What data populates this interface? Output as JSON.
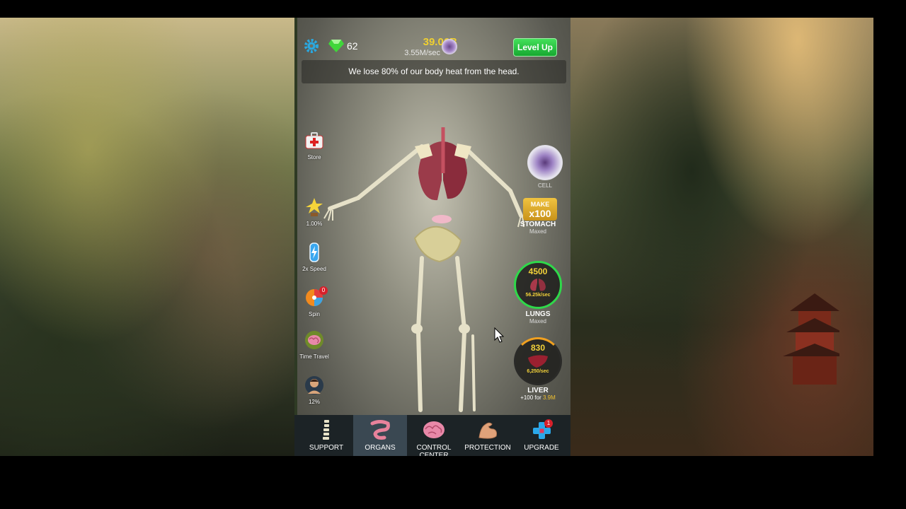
{
  "topbar": {
    "gems": "62",
    "money": "39.06B",
    "rate": "3.55M/sec",
    "level_up": "Level Up"
  },
  "fact": "We lose 80% of our body heat from the head.",
  "side_left": [
    {
      "label": "Store",
      "icon": "first-aid-kit-icon"
    },
    {
      "label": "1.00%",
      "icon": "trophy-star-icon"
    },
    {
      "label": "2x Speed",
      "icon": "battery-icon"
    },
    {
      "label": "Spin",
      "icon": "spin-wheel-icon",
      "badge": "0"
    },
    {
      "label": "Time Travel",
      "icon": "brain-icon"
    },
    {
      "label": "12%",
      "icon": "avatar"
    }
  ],
  "side_right": {
    "cell": {
      "label": "CELL"
    },
    "stomach": {
      "make_top": "MAKE",
      "make_bottom": "x100",
      "label": "STOMACH",
      "status": "Maxed"
    },
    "lungs": {
      "count": "4500",
      "speed": "56.25k/sec",
      "label": "LUNGS",
      "status": "Maxed"
    },
    "liver": {
      "count": "830",
      "speed": "6,250/sec",
      "label": "LIVER",
      "upgrade_prefix": "+100 for ",
      "upgrade_cost": "3.9M"
    }
  },
  "nav": [
    {
      "label": "SUPPORT",
      "icon": "spine-icon"
    },
    {
      "label": "ORGANS",
      "icon": "intestine-icon",
      "active": true
    },
    {
      "label": "CONTROL CENTER",
      "icon": "brain-icon"
    },
    {
      "label": "PROTECTION",
      "icon": "muscle-arm-icon"
    },
    {
      "label": "UPGRADE",
      "icon": "plus-cross-icon",
      "badge": "1"
    }
  ],
  "colors": {
    "accent_green": "#22c33a",
    "money_gold": "#f0d030",
    "nav_bg": "#1c2326"
  }
}
